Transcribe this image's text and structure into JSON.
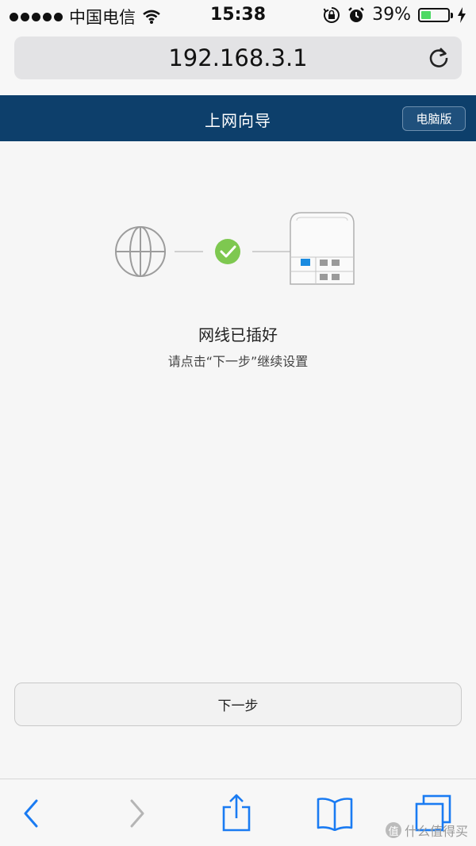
{
  "status_bar": {
    "carrier": "中国电信",
    "time": "15:38",
    "battery_text": "39%",
    "battery_level": 0.39,
    "icons": [
      "signal-dots-icon",
      "wifi-icon",
      "orientation-lock-icon",
      "alarm-icon",
      "battery-icon",
      "charging-bolt-icon"
    ]
  },
  "browser": {
    "url": "192.168.3.1",
    "reload_icon": "reload-icon"
  },
  "header": {
    "title": "上网向导",
    "desktop_button": "电脑版",
    "color": "#0d3f6b"
  },
  "illustration": {
    "icons": [
      "globe-icon",
      "check-icon",
      "router-icon"
    ],
    "check_color": "#7ec850",
    "port_active_color": "#1a8be0"
  },
  "content": {
    "status_title": "网线已插好",
    "status_desc": "请点击“下一步”继续设置"
  },
  "actions": {
    "next_label": "下一步"
  },
  "toolbar": {
    "icons": [
      "back-icon",
      "forward-icon",
      "share-icon",
      "bookmarks-icon",
      "tabs-icon"
    ],
    "accent": "#1a7bf2",
    "watermark": "什么值得买"
  }
}
